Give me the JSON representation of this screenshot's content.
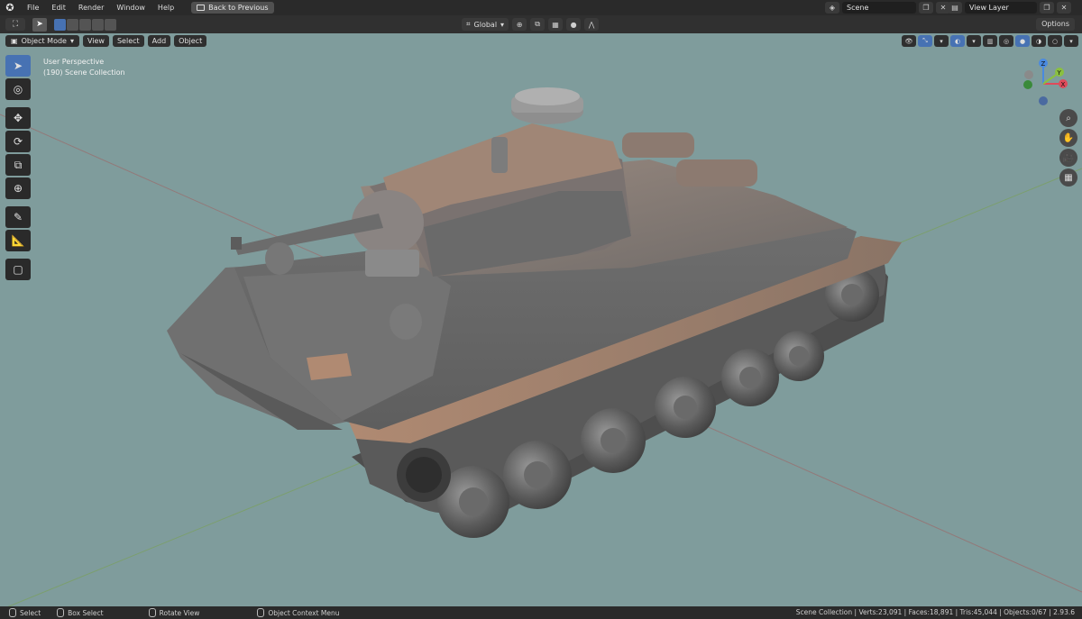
{
  "topbar": {
    "menus": [
      "File",
      "Edit",
      "Render",
      "Window",
      "Help"
    ],
    "back_button": "Back to Previous",
    "scene": "Scene",
    "view_layer": "View Layer"
  },
  "tool_header": {
    "orientation": "Global",
    "options": "Options"
  },
  "viewport": {
    "mode": "Object Mode",
    "menus": [
      "View",
      "Select",
      "Add",
      "Object"
    ],
    "perspective": "User Perspective",
    "collection": "(190) Scene Collection",
    "background_color": "#7f9c9c",
    "gizmo_axes": [
      "X",
      "Y",
      "Z"
    ]
  },
  "statusbar": {
    "select": "Select",
    "box_select": "Box Select",
    "rotate_view": "Rotate View",
    "context_menu": "Object Context Menu",
    "stats": "Scene Collection | Verts:23,091 | Faces:18,891 | Tris:45,044 | Objects:0/67 | 2.93.6"
  },
  "icons": {
    "blender_logo": "blender-logo-icon",
    "select_tool": "cursor-icon",
    "toolbar": [
      "select-box-icon",
      "cursor-3d-icon",
      "move-icon",
      "rotate-icon",
      "scale-icon",
      "transform-icon",
      "annotate-icon",
      "measure-icon",
      "add-cube-icon"
    ],
    "nav": [
      "zoom-icon",
      "pan-hand-icon",
      "camera-icon",
      "grid-icon"
    ]
  }
}
